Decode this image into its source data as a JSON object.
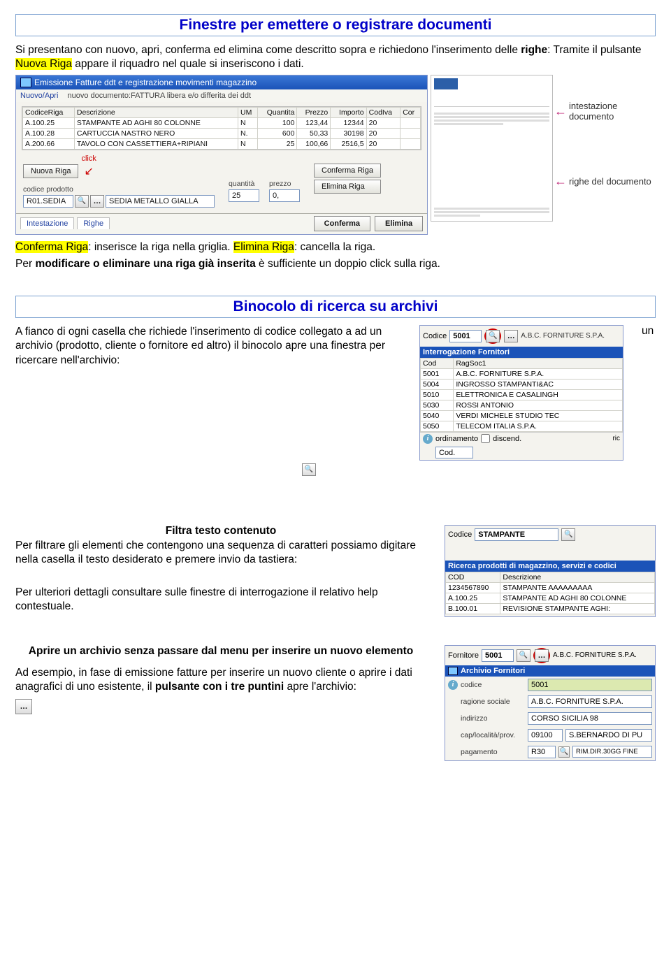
{
  "section1": {
    "title": "Finestre per emettere o registrare documenti",
    "para1a": "Si presentano con nuovo, apri, conferma ed elimina come descritto sopra e richiedono l'inserimento delle ",
    "righe": "righe",
    "para1b": ": Tramite il pulsante ",
    "nuova_riga_hl": "Nuova Riga",
    "para1c": " appare il riquadro nel quale si inseriscono i dati.",
    "conferma_hl": "Conferma Riga",
    "conferma_txt": ": inserisce la riga nella griglia. ",
    "elimina_hl": "Elimina Riga",
    "elimina_txt": ": cancella la riga.",
    "para_mod_a": "Per ",
    "para_mod_b": "modificare o eliminare una riga già inserita",
    "para_mod_c": " è sufficiente un doppio click sulla riga."
  },
  "shot1": {
    "title": "Emissione Fatture ddt e registrazione movimenti magazzino",
    "menu1": "Nuovo/Apri",
    "menu2": "nuovo documento:FATTURA libera e/o differita dei ddt",
    "cols": [
      "CodiceRiga",
      "Descrizione",
      "UM",
      "Quantita",
      "Prezzo",
      "Importo",
      "CodIva",
      "Cor"
    ],
    "rows": [
      [
        "A.100.25",
        "STAMPANTE AD AGHI 80 COLONNE",
        "N",
        "100",
        "123,44",
        "12344",
        "20",
        ""
      ],
      [
        "A.100.28",
        "CARTUCCIA NASTRO NERO",
        "N.",
        "600",
        "50,33",
        "30198",
        "20",
        ""
      ],
      [
        "A.200.66",
        "TAVOLO CON CASSETTIERA+RIPIANI",
        "N",
        "25",
        "100,66",
        "2516,5",
        "20",
        ""
      ]
    ],
    "btn_nuova": "Nuova Riga",
    "click": "click",
    "lbl_codice": "codice prodotto",
    "val_codice": "R01.SEDIA",
    "val_desc": "SEDIA METALLO GIALLA",
    "lbl_qta": "quantità",
    "val_qta": "25",
    "lbl_prezzo": "prezzo",
    "val_prezzo": "0,",
    "btn_confr": "Conferma Riga",
    "btn_elimr": "Elimina Riga",
    "tab1": "Intestazione",
    "tab2": "Righe",
    "btn_conf": "Conferma",
    "btn_elim": "Elimina",
    "call1": "intestazione documento",
    "call2": "righe del documento",
    "thumb_logo": " "
  },
  "section2": {
    "title": "Binocolo di ricerca su archivi",
    "para_a": "A fianco di ogni casella che richiede l'inserimento di codice collegato a ad un archivio (prodotto,  cliente o fornitore ed altro) il binocolo apre una finestra per ricercare nell'archivio:",
    "un": "un"
  },
  "shot2": {
    "lbl_codice": "Codice",
    "val_codice": "5001",
    "header_txt": "A.B.C. FORNITURE S.P.A.",
    "blue": "Interrogazione Fornitori",
    "cols": [
      "Cod",
      "RagSoc1"
    ],
    "rows": [
      [
        "5001",
        "A.B.C. FORNITURE S.P.A."
      ],
      [
        "5004",
        "INGROSSO STAMPANTI&AC"
      ],
      [
        "5010",
        "ELETTRONICA E CASALINGH"
      ],
      [
        "5030",
        "ROSSI ANTONIO"
      ],
      [
        "5040",
        "VERDI MICHELE STUDIO TEC"
      ],
      [
        "5050",
        "TELECOM ITALIA S.P.A."
      ]
    ],
    "ord": "ordinamento",
    "discend": "discend.",
    "ric": "ric",
    "cod": "Cod."
  },
  "section3": {
    "subhead": "Filtra testo contenuto",
    "para": "Per filtrare gli elementi che contengono una sequenza di caratteri possiamo digitare nella casella il testo desiderato e premere invio da tastiera:",
    "para2": "Per ulteriori dettagli consultare sulle finestre di interrogazione il relativo help contestuale."
  },
  "shot3": {
    "lbl_codice": "Codice",
    "val_codice": "STAMPANTE",
    "blue": "Ricerca prodotti di magazzino, servizi e codici",
    "cols": [
      "COD",
      "Descrizione"
    ],
    "rows": [
      [
        "1234567890",
        "STAMPANTE AAAAAAAAA"
      ],
      [
        "A.100.25",
        "STAMPANTE AD AGHI 80 COLONNE"
      ],
      [
        "B.100.01",
        "REVISIONE STAMPANTE AGHI:"
      ]
    ]
  },
  "section4": {
    "head": "Aprire un archivio senza passare dal menu per inserire un nuovo elemento",
    "para_a": "Ad esempio, in fase di emissione fatture per inserire un nuovo cliente o aprire i dati anagrafici di uno esistente, il ",
    "para_b": "pulsante con i tre puntini",
    "para_c": " apre l'archivio:"
  },
  "shot4": {
    "lbl_forn": "Fornitore",
    "val_forn": "5001",
    "head_txt": "A.B.C. FORNITURE S.P.A.",
    "blue": "Archivio Fornitori",
    "f_cod_l": "codice",
    "f_cod_v": "5001",
    "f_rag_l": "ragione sociale",
    "f_rag_v": "A.B.C. FORNITURE S.P.A.",
    "f_ind_l": "indirizzo",
    "f_ind_v": "CORSO SICILIA 98",
    "f_cap_l": "cap/località/prov.",
    "f_cap_v1": "09100",
    "f_cap_v2": "S.BERNARDO DI PU",
    "f_pag_l": "pagamento",
    "f_pag_v1": "R30",
    "f_pag_v2": "RIM.DIR.30GG FINE"
  }
}
